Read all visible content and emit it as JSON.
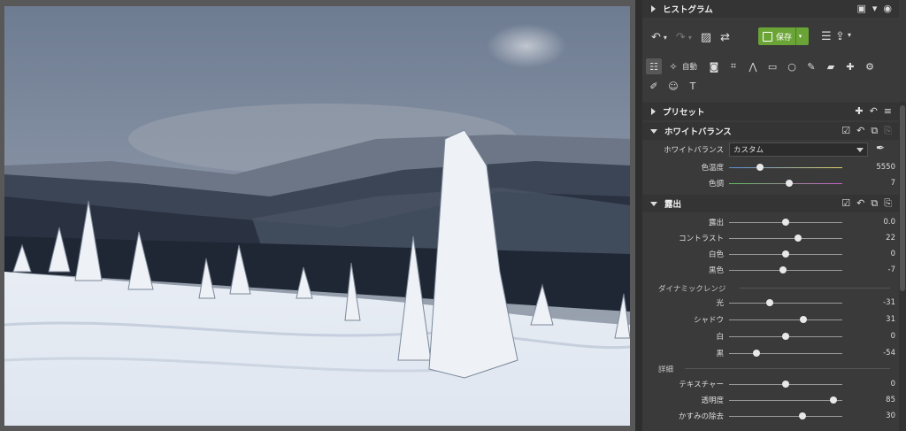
{
  "panel": {
    "histogram": {
      "title": "ヒストグラム"
    },
    "toolbar": {
      "save_label": "保存",
      "save_dropdown": "▾"
    },
    "tools": {
      "auto_label": "自動"
    },
    "presets": {
      "title": "プリセット"
    },
    "white_balance": {
      "title": "ホワイトバランス",
      "mode_label": "ホワイトバランス",
      "mode_value": "カスタム",
      "sliders": [
        {
          "label": "色温度",
          "value": "5550",
          "position": 0.27
        },
        {
          "label": "色調",
          "value": "7",
          "position": 0.53
        }
      ]
    },
    "exposure": {
      "title": "露出",
      "sliders": [
        {
          "label": "露出",
          "value": "0.0",
          "position": 0.5
        },
        {
          "label": "コントラスト",
          "value": "22",
          "position": 0.61
        },
        {
          "label": "白色",
          "value": "0",
          "position": 0.5
        },
        {
          "label": "黒色",
          "value": "-7",
          "position": 0.48
        }
      ],
      "dynamic_range": {
        "title": "ダイナミックレンジ",
        "sliders": [
          {
            "label": "光",
            "value": "-31",
            "position": 0.36
          },
          {
            "label": "シャドウ",
            "value": "31",
            "position": 0.66
          },
          {
            "label": "白",
            "value": "0",
            "position": 0.5
          },
          {
            "label": "黒",
            "value": "-54",
            "position": 0.24
          }
        ]
      },
      "detail": {
        "title": "詳細",
        "sliders": [
          {
            "label": "テキスチャー",
            "value": "0",
            "position": 0.5
          },
          {
            "label": "透明度",
            "value": "85",
            "position": 0.92
          },
          {
            "label": "かすみの除去",
            "value": "30",
            "position": 0.65
          }
        ]
      }
    }
  },
  "colors": {
    "save_green": "#6aa436",
    "panel_bg": "#3a3a3a",
    "viewer_bg": "#585858"
  }
}
